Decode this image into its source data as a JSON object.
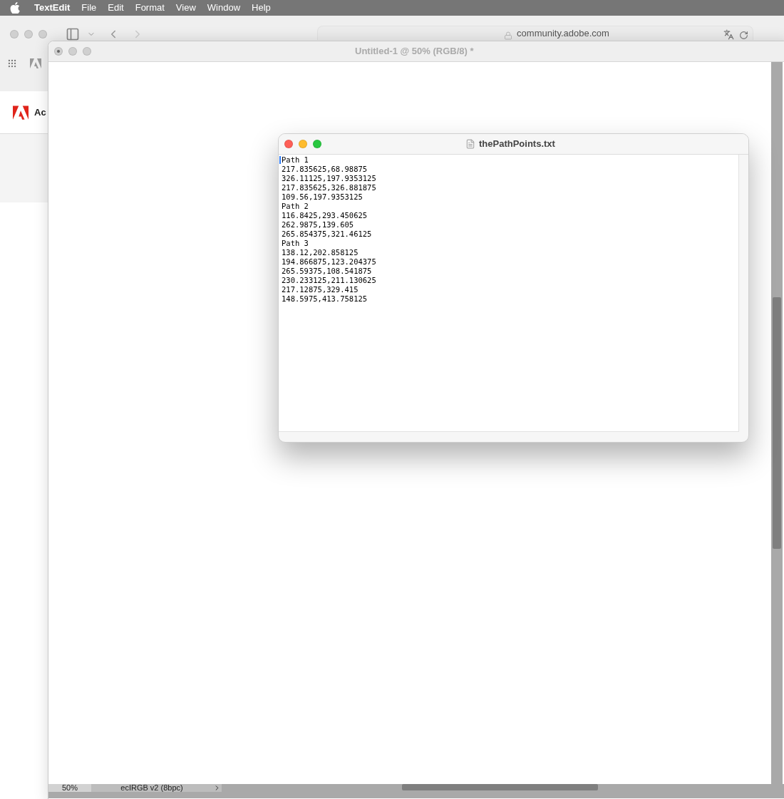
{
  "menu_bar": {
    "app": "TextEdit",
    "items": [
      "File",
      "Edit",
      "Format",
      "View",
      "Window",
      "Help"
    ]
  },
  "browser": {
    "url": "community.adobe.com",
    "site_title": "Ac"
  },
  "photoshop_window": {
    "title": "Untitled-1 @ 50% (RGB/8) *",
    "status_bar": {
      "zoom": "50%",
      "profile": "ecIRGB v2 (8bpc)"
    }
  },
  "text_window": {
    "title": "thePathPoints.txt",
    "lines": [
      "Path 1",
      "217.835625,68.98875",
      "326.11125,197.9353125",
      "217.835625,326.881875",
      "109.56,197.9353125",
      "Path 2",
      "116.8425,293.450625",
      "262.9875,139.605",
      "265.854375,321.46125",
      "Path 3",
      "138.12,202.858125",
      "194.866875,123.204375",
      "265.59375,108.541875",
      "230.233125,211.130625",
      "217.12875,329.415",
      "148.5975,413.758125"
    ]
  }
}
